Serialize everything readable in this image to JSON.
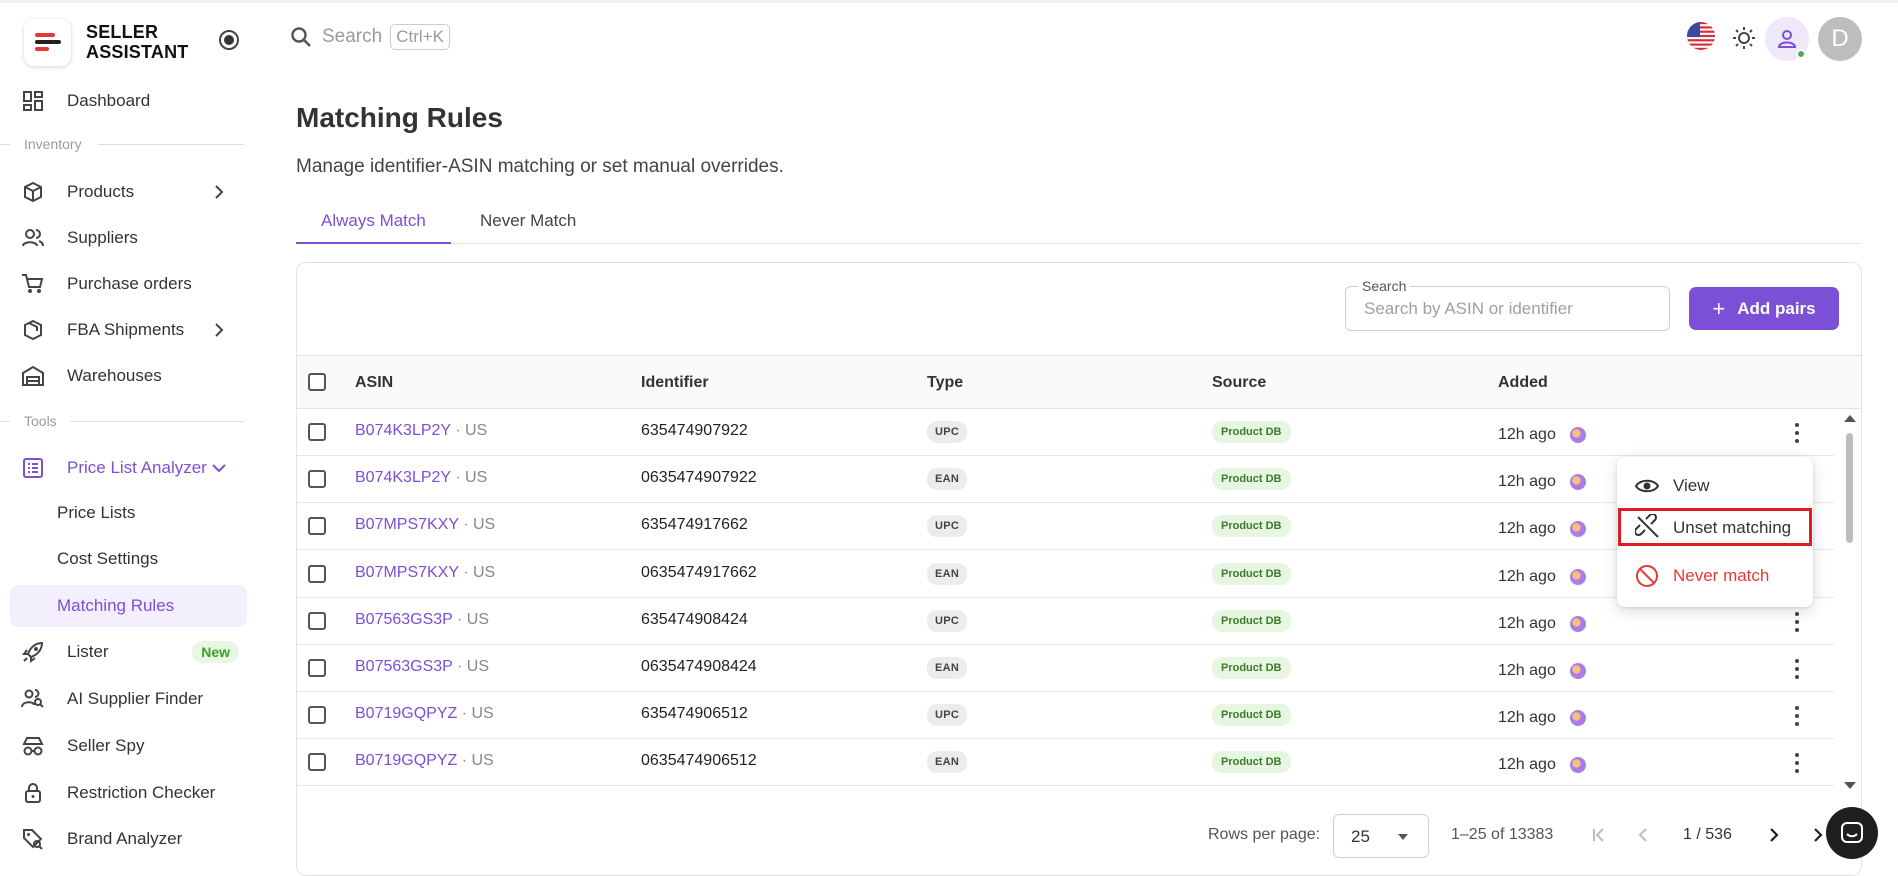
{
  "app": {
    "brand_line1": "SELLER",
    "brand_line2": "ASSISTANT"
  },
  "topbar": {
    "search_label": "Search",
    "search_shortcut": "Ctrl+K",
    "user_initial": "D"
  },
  "sidebar": {
    "dashboard": "Dashboard",
    "section_inventory": "Inventory",
    "products": "Products",
    "suppliers": "Suppliers",
    "purchase_orders": "Purchase orders",
    "fba_shipments": "FBA Shipments",
    "warehouses": "Warehouses",
    "section_tools": "Tools",
    "price_list_analyzer": "Price List Analyzer",
    "price_lists": "Price Lists",
    "cost_settings": "Cost Settings",
    "matching_rules": "Matching Rules",
    "lister": "Lister",
    "lister_badge": "New",
    "ai_supplier_finder": "AI Supplier Finder",
    "seller_spy": "Seller Spy",
    "restriction_checker": "Restriction Checker",
    "brand_analyzer": "Brand Analyzer"
  },
  "page": {
    "title": "Matching Rules",
    "subtitle": "Manage identifier-ASIN matching or set manual overrides.",
    "tabs": [
      "Always Match",
      "Never Match"
    ],
    "active_tab": "Always Match"
  },
  "toolbar": {
    "search_legend": "Search",
    "search_placeholder": "Search by ASIN or identifier",
    "add_button": "Add pairs"
  },
  "table": {
    "columns": [
      "ASIN",
      "Identifier",
      "Type",
      "Source",
      "Added"
    ],
    "rows": [
      {
        "asin": "B074K3LP2Y",
        "market": " · US",
        "identifier": "635474907922",
        "type": "UPC",
        "source": "Product DB",
        "added": "12h ago"
      },
      {
        "asin": "B074K3LP2Y",
        "market": " · US",
        "identifier": "0635474907922",
        "type": "EAN",
        "source": "Product DB",
        "added": "12h ago"
      },
      {
        "asin": "B07MPS7KXY",
        "market": " · US",
        "identifier": "635474917662",
        "type": "UPC",
        "source": "Product DB",
        "added": "12h ago"
      },
      {
        "asin": "B07MPS7KXY",
        "market": " · US",
        "identifier": "0635474917662",
        "type": "EAN",
        "source": "Product DB",
        "added": "12h ago"
      },
      {
        "asin": "B07563GS3P",
        "market": " · US",
        "identifier": "635474908424",
        "type": "UPC",
        "source": "Product DB",
        "added": "12h ago"
      },
      {
        "asin": "B07563GS3P",
        "market": " · US",
        "identifier": "0635474908424",
        "type": "EAN",
        "source": "Product DB",
        "added": "12h ago"
      },
      {
        "asin": "B0719GQPYZ",
        "market": " · US",
        "identifier": "635474906512",
        "type": "UPC",
        "source": "Product DB",
        "added": "12h ago"
      },
      {
        "asin": "B0719GQPYZ",
        "market": " · US",
        "identifier": "0635474906512",
        "type": "EAN",
        "source": "Product DB",
        "added": "12h ago"
      }
    ]
  },
  "row_menu": {
    "view": "View",
    "unset": "Unset matching",
    "never": "Never match"
  },
  "pagination": {
    "rows_per_page_label": "Rows per page:",
    "rows_per_page": "25",
    "range": "1–25 of 13383",
    "page": "1 / 536"
  },
  "colors": {
    "accent": "#7b4fd6",
    "danger": "#e53935",
    "highlight_outline": "#e01b24"
  }
}
